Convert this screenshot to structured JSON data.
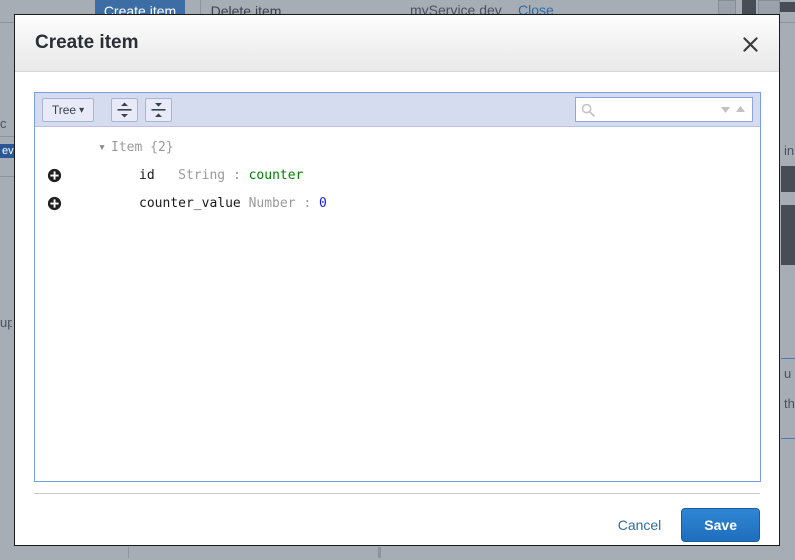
{
  "background": {
    "tabs": [
      {
        "label": "Create item",
        "selected": true
      },
      {
        "label": "Delete item",
        "selected": false
      }
    ],
    "service_label": "myService dev",
    "close_link": "Close",
    "fragments": [
      {
        "text": "c"
      },
      {
        "text": "ev"
      },
      {
        "text": "up"
      },
      {
        "text": "in"
      },
      {
        "text": "u"
      },
      {
        "text": "th"
      }
    ]
  },
  "modal": {
    "title": "Create item",
    "close_icon": "close-icon",
    "editor": {
      "mode_label": "Tree",
      "mode_caret": "▾",
      "expand_all_title": "Expand all",
      "collapse_all_title": "Collapse all",
      "search": {
        "value": "",
        "placeholder": "",
        "icon": "search-icon",
        "next_icon": "chevron-down-icon",
        "prev_icon": "chevron-up-icon"
      },
      "tree": {
        "root": {
          "expander": "▾",
          "field": "Item",
          "count": "{2}"
        },
        "rows": [
          {
            "add_icon": "add-circle-icon",
            "field": "id",
            "type": "String",
            "colon": ":",
            "value": "counter",
            "value_kind": "string"
          },
          {
            "add_icon": "add-circle-icon",
            "field": "counter_value",
            "type": "Number",
            "colon": ":",
            "value": "0",
            "value_kind": "number"
          }
        ]
      }
    },
    "footer": {
      "cancel_label": "Cancel",
      "save_label": "Save"
    }
  },
  "colors": {
    "accent": "#1e6fbd",
    "link": "#2d6ca5",
    "string_value": "#008000",
    "number_value": "#1a1ae6",
    "toolbar_bg": "#d6dcf0",
    "editor_border": "#7a9ee0"
  }
}
